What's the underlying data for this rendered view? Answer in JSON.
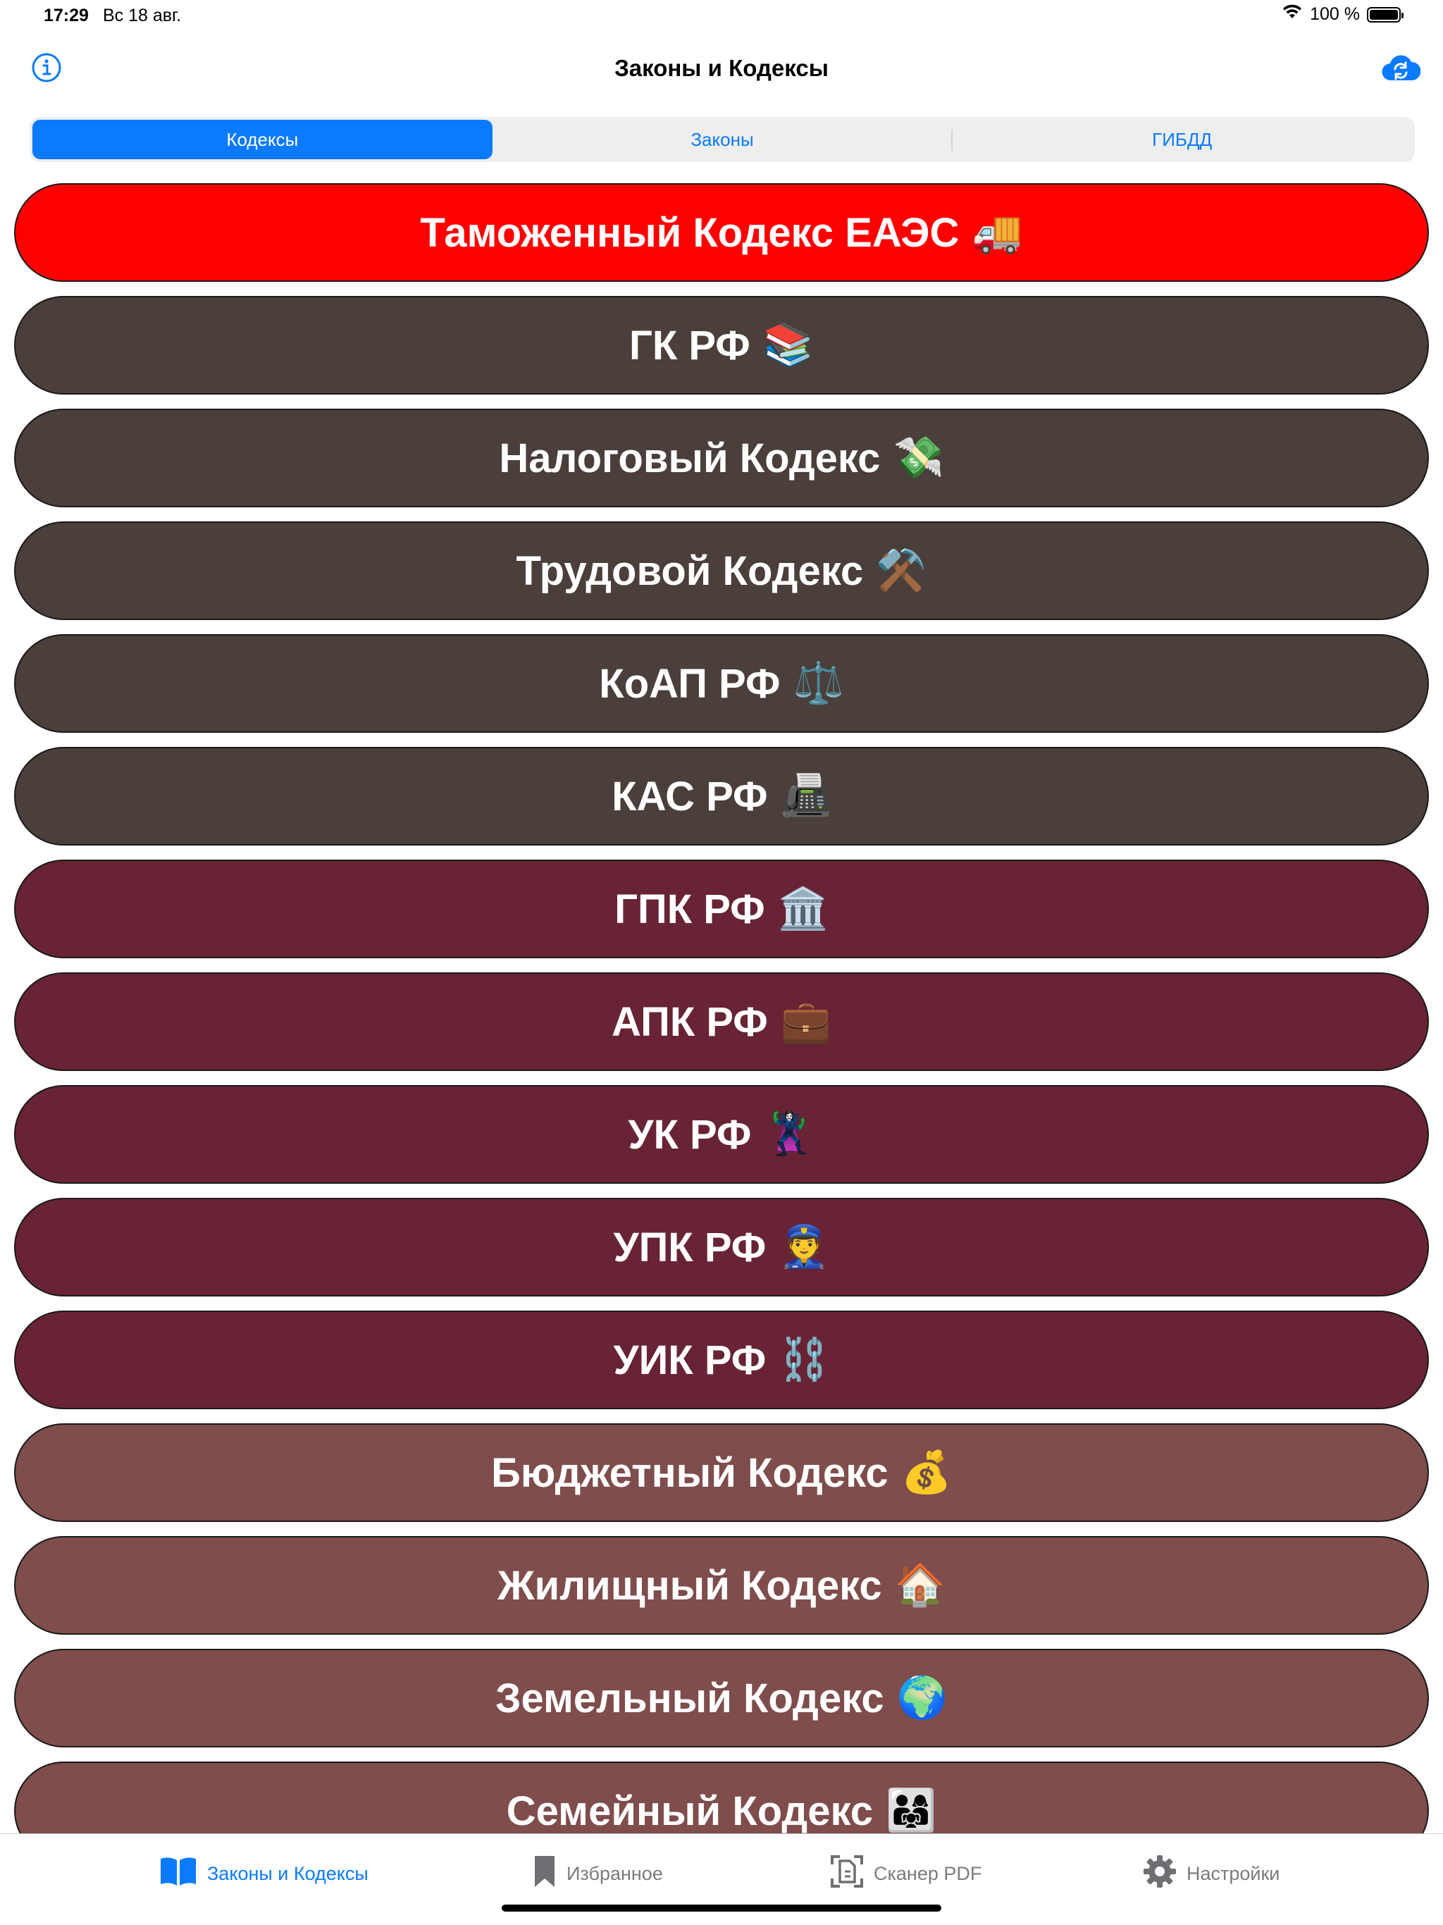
{
  "status_bar": {
    "time": "17:29",
    "date": "Вс 18 авг.",
    "battery": "100 %"
  },
  "nav": {
    "title": "Законы и Кодексы",
    "left_icon": "info-icon",
    "right_icon": "cloud-sync-icon"
  },
  "segments": [
    {
      "label": "Кодексы",
      "selected": true
    },
    {
      "label": "Законы",
      "selected": false
    },
    {
      "label": "ГИБДД",
      "selected": false
    }
  ],
  "codes": [
    {
      "label": "Таможенный Кодекс ЕАЭС",
      "emoji": "🚚",
      "color": "#ff0000"
    },
    {
      "label": "ГК РФ",
      "emoji": "📚",
      "color": "#4a3f3b"
    },
    {
      "label": "Налоговый Кодекс",
      "emoji": "💸",
      "color": "#4a3f3b"
    },
    {
      "label": "Трудовой Кодекс",
      "emoji": "⚒️",
      "color": "#4a3f3b"
    },
    {
      "label": "КоАП РФ",
      "emoji": "⚖️",
      "color": "#4a3f3b"
    },
    {
      "label": "КАС РФ",
      "emoji": "📠",
      "color": "#4a3f3b"
    },
    {
      "label": "ГПК РФ",
      "emoji": "🏛️",
      "color": "#682434"
    },
    {
      "label": "АПК РФ",
      "emoji": "💼",
      "color": "#682434"
    },
    {
      "label": "УК РФ",
      "emoji": "🦹‍♀️",
      "color": "#682434"
    },
    {
      "label": "УПК РФ",
      "emoji": "👮",
      "color": "#682434"
    },
    {
      "label": "УИК РФ",
      "emoji": "⛓️",
      "color": "#682434"
    },
    {
      "label": "Бюджетный Кодекс",
      "emoji": "💰",
      "color": "#7e4d4c"
    },
    {
      "label": "Жилищный Кодекс",
      "emoji": "🏠",
      "color": "#7e4d4c"
    },
    {
      "label": "Земельный Кодекс",
      "emoji": "🌍",
      "color": "#7e4d4c"
    },
    {
      "label": "Семейный Кодекс",
      "emoji": "👨‍👩‍👧",
      "color": "#7e4d4c"
    }
  ],
  "tabs": [
    {
      "label": "Законы и Кодексы",
      "icon": "book-icon",
      "active": true
    },
    {
      "label": "Избранное",
      "icon": "bookmark-icon",
      "active": false
    },
    {
      "label": "Сканер PDF",
      "icon": "scanner-icon",
      "active": false
    },
    {
      "label": "Настройки",
      "icon": "gear-icon",
      "active": false
    }
  ],
  "colors": {
    "accent": "#0a7aff"
  }
}
